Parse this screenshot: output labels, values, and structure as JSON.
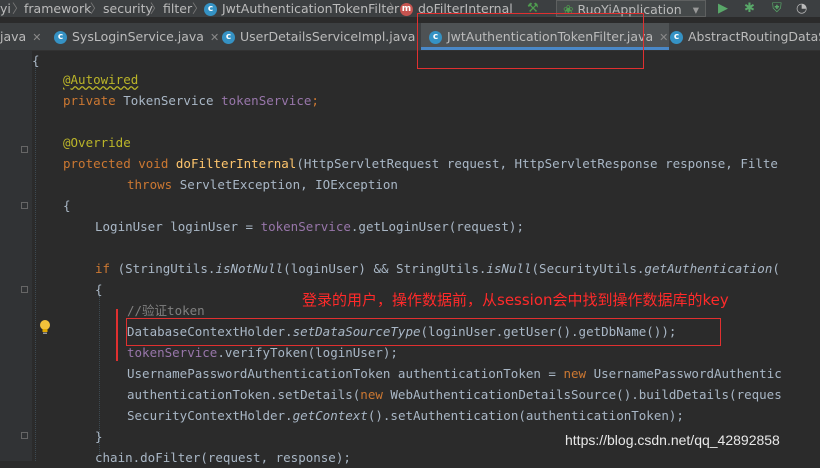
{
  "breadcrumb": {
    "items": [
      "yi",
      "framework",
      "security",
      "filter",
      "JwtAuthenticationTokenFilter",
      "doFilterInternal"
    ],
    "class_icon": "class-c-icon",
    "method_icon": "method-m-icon"
  },
  "toolbar": {
    "hammer_icon": "hammer-icon",
    "run_config": "RuoYiApplication",
    "run_icon": "play-icon",
    "debug_icon": "bug-icon",
    "coverage_icon": "coverage-icon"
  },
  "tabs": [
    {
      "label": "java",
      "closable": true
    },
    {
      "label": "SysLoginService.java",
      "closable": true
    },
    {
      "label": "UserDetailsServiceImpl.java",
      "closable": true
    },
    {
      "label": "JwtAuthenticationTokenFilter.java",
      "closable": true,
      "active": true
    },
    {
      "label": "AbstractRoutingDataSo",
      "closable": false
    }
  ],
  "code": {
    "line1": "{",
    "line2": "@Autowired",
    "line3_kw": "private",
    "line3_type": "TokenService",
    "line3_field": "tokenService",
    "line5": "@Override",
    "line6_kw": "protected void",
    "line6_fn": "doFilterInternal",
    "line6_params": "(HttpServletRequest request, HttpServletResponse response, Filte",
    "line7_kw": "throws",
    "line7_rest": "ServletException, IOException",
    "line8": "{",
    "line9_type": "LoginUser loginUser = ",
    "line9_field": "tokenService",
    "line9_rest": ".getLoginUser(request);",
    "line11_kw": "if",
    "line11_a": "(StringUtils.",
    "line11_b": "isNotNull",
    "line11_c": "(loginUser) && StringUtils.",
    "line11_d": "isNull",
    "line11_e": "(SecurityUtils.",
    "line11_f": "getAuthentication",
    "line11_g": "(",
    "line12": "{",
    "line13": "//验证token",
    "line14_a": "DatabaseContextHolder.",
    "line14_b": "setDataSourceType",
    "line14_c": "(loginUser.getUser().getDbName());",
    "line15_field": "tokenService",
    "line15_rest": ".verifyToken(loginUser);",
    "line16_a": "UsernamePasswordAuthenticationToken authenticationToken = ",
    "line16_kw": "new",
    "line16_b": " UsernamePasswordAuthentic",
    "line17_a": "authenticationToken.setDetails(",
    "line17_kw": "new",
    "line17_b": " WebAuthenticationDetailsSource().buildDetails(reques",
    "line18_a": "SecurityContextHolder.",
    "line18_b": "getContext",
    "line18_c": "().setAuthentication(authenticationToken);",
    "line19": "}",
    "line20": "chain.doFilter(request, response);"
  },
  "annotation_note": "登录的用户，操作数据前，从session会中找到操作数据库的key",
  "watermark": "https://blog.csdn.net/qq_42892858",
  "colors": {
    "editor_bg": "#2b2b2b",
    "keyword": "#cc7832",
    "annotation": "#bbb529",
    "method": "#ffc66d",
    "field": "#9876aa",
    "highlight_red": "#e03030"
  }
}
